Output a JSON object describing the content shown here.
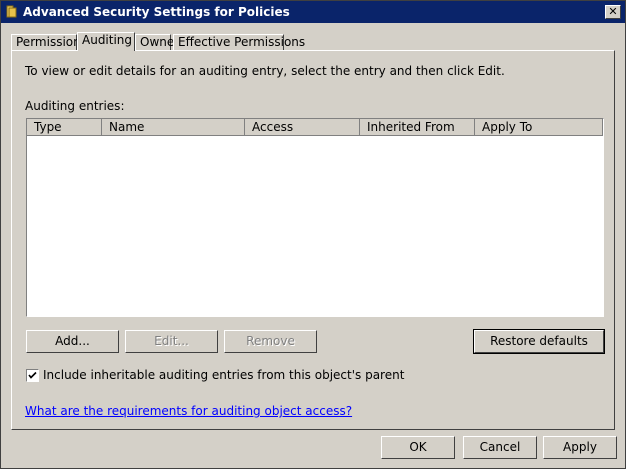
{
  "window": {
    "title": "Advanced Security Settings for Policies",
    "close_glyph": "✕"
  },
  "tabs": [
    {
      "label": "Permissions",
      "active": false
    },
    {
      "label": "Auditing",
      "active": true
    },
    {
      "label": "Owner",
      "active": false
    },
    {
      "label": "Effective Permissions",
      "active": false
    }
  ],
  "auditing": {
    "info_text": "To view or edit details for an auditing entry, select the entry and then click Edit.",
    "entries_label": "Auditing entries:",
    "columns": [
      "Type",
      "Name",
      "Access",
      "Inherited From",
      "Apply To"
    ],
    "rows": [],
    "buttons": {
      "add": "Add...",
      "edit": "Edit...",
      "remove": "Remove",
      "restore": "Restore defaults"
    },
    "include_inheritable": {
      "label": "Include inheritable auditing entries from this object's parent",
      "checked": true
    },
    "help_link": "What are the requirements for auditing object access?"
  },
  "dialog_buttons": {
    "ok": "OK",
    "cancel": "Cancel",
    "apply": "Apply"
  },
  "colors": {
    "title_bar": "#0a246a",
    "face": "#d4d0c8",
    "link": "#0000ff"
  }
}
